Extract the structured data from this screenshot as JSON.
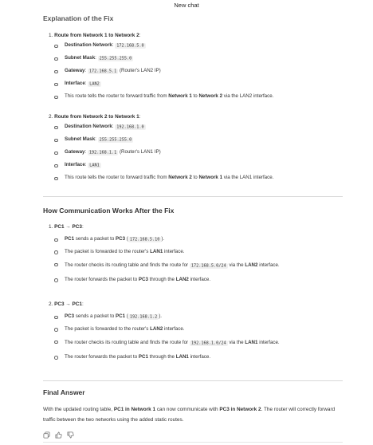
{
  "window": {
    "title": "New chat"
  },
  "section1": {
    "title": "Explanation of the Fix",
    "items": [
      {
        "num": "1.",
        "heading": "Route from Network 1 to Network 2",
        "rows": [
          {
            "label": "Destination Network",
            "code": "172.168.5.0",
            "after": ""
          },
          {
            "label": "Subnet Mask",
            "code": "255.255.255.0",
            "after": ""
          },
          {
            "label": "Gateway",
            "code": "172.168.5.1",
            "after": "(Router's LAN2 IP)"
          },
          {
            "label": "Interface",
            "code": "LAN2",
            "after": ""
          }
        ],
        "note_pre": "This route tells the router to forward traffic from",
        "note_a": "Network 1",
        "note_mid": "to",
        "note_b": "Network 2",
        "note_post": "via the LAN2 interface."
      },
      {
        "num": "2.",
        "heading": "Route from Network 2 to Network 1",
        "rows": [
          {
            "label": "Destination Network",
            "code": "192.168.1.0",
            "after": ""
          },
          {
            "label": "Subnet Mask",
            "code": "255.255.255.0",
            "after": ""
          },
          {
            "label": "Gateway",
            "code": "192.168.1.1",
            "after": "(Router's LAN1 IP)"
          },
          {
            "label": "Interface",
            "code": "LAN1",
            "after": ""
          }
        ],
        "note_pre": "This route tells the router to forward traffic from",
        "note_a": "Network 2",
        "note_mid": "to",
        "note_b": "Network 1",
        "note_post": "via the LAN1 interface."
      }
    ]
  },
  "section2": {
    "title": "How Communication Works After the Fix",
    "flow1": {
      "num": "1.",
      "heading": "PC1 → PC3",
      "l1_a": "PC1",
      "l1_mid": "sends a packet to",
      "l1_b": "PC3",
      "l1_code": "172.168.5.10",
      "l2_pre": "The packet is forwarded to the router's",
      "l2_b": "LAN1",
      "l2_post": "interface.",
      "l3_pre": "The router checks its routing table and finds the route for",
      "l3_code": "172.168.5.0/24",
      "l3_mid": "via the",
      "l3_b": "LAN2",
      "l3_post": "interface.",
      "l4_pre": "The router forwards the packet to",
      "l4_b1": "PC3",
      "l4_mid": "through the",
      "l4_b2": "LAN2",
      "l4_post": "interface."
    },
    "flow2": {
      "num": "2.",
      "heading": "PC3 → PC1",
      "l1_a": "PC3",
      "l1_mid": "sends a packet to",
      "l1_b": "PC1",
      "l1_code": "192.168.1.2",
      "l2_pre": "The packet is forwarded to the router's",
      "l2_b": "LAN2",
      "l2_post": "interface.",
      "l3_pre": "The router checks its routing table and finds the route for",
      "l3_code": "192.168.1.0/24",
      "l3_mid": "via the",
      "l3_b": "LAN1",
      "l3_post": "interface.",
      "l4_pre": "The router forwards the packet to",
      "l4_b1": "PC1",
      "l4_mid": "through the",
      "l4_b2": "LAN1",
      "l4_post": "interface."
    }
  },
  "section3": {
    "title": "Final Answer",
    "p_pre": "With the updated routing table,",
    "p_b1": "PC1 in Network 1",
    "p_mid": "can now communicate with",
    "p_b2": "PC3 in Network 2",
    "p_post": ". The router will correctly forward traffic between the two networks using the added static routes."
  },
  "actions": {
    "copy_icon": "copy-icon",
    "like_icon": "thumbs-up-icon",
    "dislike_icon": "thumbs-down-icon"
  }
}
